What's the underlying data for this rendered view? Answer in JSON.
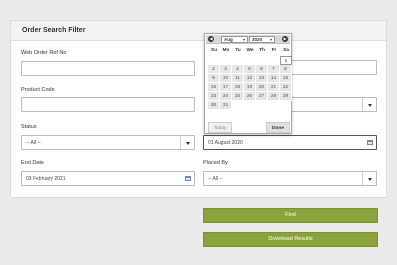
{
  "panel": {
    "title": "Order Search Filter"
  },
  "fields": {
    "web_order_ref": {
      "label": "Web Order Ref No",
      "value": ""
    },
    "product_code": {
      "label": "Product Code",
      "value": ""
    },
    "status": {
      "label": "Status",
      "value": "-- All --"
    },
    "end_date": {
      "label": "End Date",
      "value": "03 February 2021"
    },
    "start_date": {
      "value": "01 August 2020"
    },
    "placed_by": {
      "label": "Placed By",
      "value": "-- All --"
    }
  },
  "buttons": {
    "find": "Find",
    "download": "Download Results"
  },
  "datepicker": {
    "prev_icon": "prev-arrow-icon",
    "next_icon": "next-arrow-icon",
    "month": "Aug",
    "year": "2020",
    "weekdays": [
      "Su",
      "Mo",
      "Tu",
      "We",
      "Th",
      "Fr",
      "Sa"
    ],
    "days": [
      "1",
      "2",
      "3",
      "4",
      "5",
      "6",
      "7",
      "8",
      "9",
      "10",
      "11",
      "12",
      "13",
      "14",
      "15",
      "16",
      "17",
      "18",
      "19",
      "20",
      "21",
      "22",
      "23",
      "24",
      "25",
      "26",
      "27",
      "28",
      "29",
      "30",
      "31"
    ],
    "first_weekday_index": 6,
    "today_label": "Today",
    "done_label": "Done"
  },
  "colors": {
    "button_green": "#8aa33c",
    "panel_bg": "#ffffff",
    "page_bg": "#ebebeb"
  }
}
